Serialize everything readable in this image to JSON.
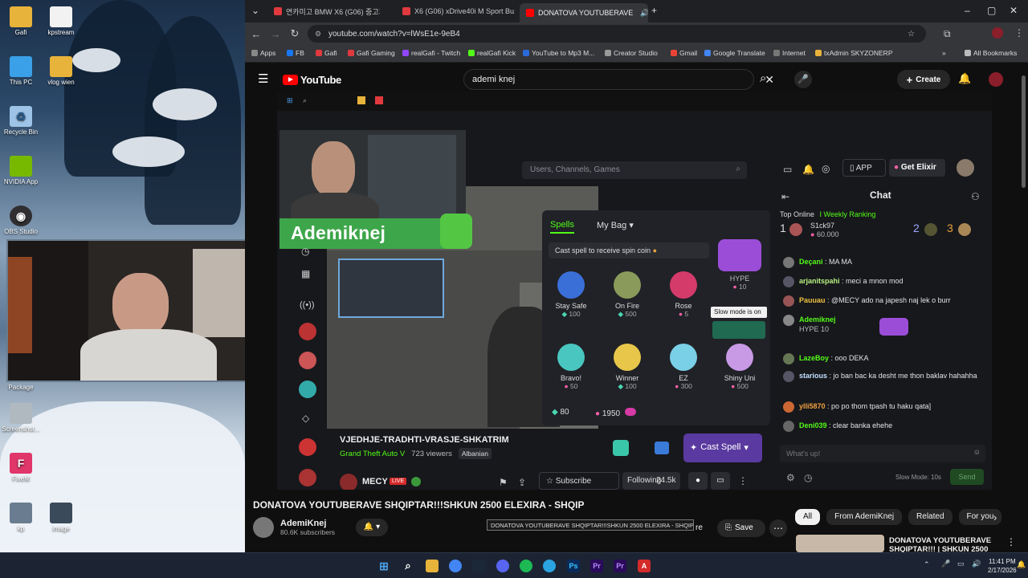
{
  "desktop": {
    "icons": [
      {
        "label": "Gafi",
        "name": "folder-icon",
        "color": "#e8b33a"
      },
      {
        "label": "kpstream",
        "name": "file-icon",
        "color": "#f2f2f2"
      },
      {
        "label": "This PC",
        "name": "computer-icon",
        "color": "#3aa0e8"
      },
      {
        "label": "vlog wien",
        "name": "folder-icon",
        "color": "#e8b33a"
      },
      {
        "label": "Recycle Bin",
        "name": "recycle-bin-icon",
        "color": "#9dc3e6"
      },
      {
        "label": "NVIDIA App",
        "name": "nvidia-icon",
        "color": "#76b900"
      },
      {
        "label": "OBS Studio",
        "name": "obs-icon",
        "color": "#302e31"
      },
      {
        "label": "Package",
        "name": "package-icon",
        "color": "#6a7d90"
      },
      {
        "label": "Screenshot...",
        "name": "screenshot-icon",
        "color": "#b0b8c0"
      },
      {
        "label": "FiveM",
        "name": "fivem-icon",
        "color": "#e0366a"
      },
      {
        "label": "kp",
        "name": "file-icon",
        "color": "#6a7d90"
      },
      {
        "label": "image",
        "name": "image-icon",
        "color": "#3a4a5a"
      }
    ]
  },
  "browser": {
    "tabs": [
      {
        "title": "연카미고 BMW X6 (G06) 중고차",
        "active": false
      },
      {
        "title": "X6 (G06) xDrive40i M Sport Bu...",
        "active": false
      },
      {
        "title": "DONATOVA YOUTUBERAVE",
        "active": true
      }
    ],
    "new_tab": "+",
    "url": "youtube.com/watch?v=lWsE1e-9eB4",
    "bookmarks": [
      "Apps",
      "FB",
      "Gafi",
      "Gafi Gaming",
      "realGafi - Twitch",
      "realGafi Kick",
      "YouTube to Mp3 M...",
      "Creator Studio",
      "Gmail",
      "Google Translate",
      "Internet",
      "txAdmin SKYZONERP"
    ],
    "bookmarks_more": "»",
    "all_bookmarks": "All Bookmarks"
  },
  "youtube": {
    "logo": "YouTube",
    "search_value": "ademi knej",
    "create_label": "Create",
    "video_title": "DONATOVA YOUTUBERAVE SHQIPTAR!!!SHKUN 2500 ELEXIRA - SHQIP",
    "tooltip": "DONATOVA YOUTUBERAVE SHQIPTAR!!!SHKUN 2500 ELEXIRA - SHQIP",
    "channel_name": "AdemiKnej",
    "subscribers": "80.6K subscribers",
    "save_label": "Save",
    "share_partial": "re",
    "chips": [
      "All",
      "From AdemiKnej",
      "Related",
      "For you"
    ],
    "reco_title": "DONATOVA YOUTUBERAVE SHQIPTAR!!! | SHKUN 2500"
  },
  "kick": {
    "search_placeholder": "Users, Channels, Games",
    "app_label": "APP",
    "get_elixir": "Get Elixir",
    "streamer_banner": "Ademiknej",
    "chat_title": "Chat",
    "top_online": "Top Online",
    "weekly_ranking": "I Weekly Ranking",
    "top_user": "S1ck97",
    "top_value": "60.000",
    "rank1": "1",
    "rank2": "2",
    "rank3": "3",
    "spells_tab": "Spells",
    "bag_tab": "My Bag",
    "cast_hint": "Cast spell to receive spin coin",
    "spells": [
      {
        "name": "Stay Safe",
        "cost": "100",
        "color": "#3b6fd8"
      },
      {
        "name": "On Fire",
        "cost": "500",
        "color": "#8a9a5a"
      },
      {
        "name": "Rose",
        "cost": "5",
        "color": "#d43a6a"
      },
      {
        "name": "HYPE",
        "cost": "10",
        "color": "#9b4dd8"
      },
      {
        "name": "Bravo!",
        "cost": "50",
        "color": "#4ac6c0"
      },
      {
        "name": "Winner",
        "cost": "100",
        "color": "#e8c64a"
      },
      {
        "name": "EZ",
        "cost": "300",
        "color": "#7ad0e6"
      },
      {
        "name": "Shiny Uni",
        "cost": "500",
        "color": "#c89ae6"
      }
    ],
    "slow_mode_tip": "Slow mode is on",
    "balance_green": "80",
    "balance_pink": "1950",
    "stream_title": "VJEDHJE-TRADHTI-VRASJE-SHKATRIM",
    "category": "Grand Theft Auto V",
    "viewers": "723 viewers",
    "language": "Albanian",
    "cast_spell_label": "Cast Spell",
    "channel_name": "MECY",
    "live_badge": "LIVE",
    "subscribe_label": "Subscribe",
    "following_label": "Following",
    "followers": "24.5k",
    "chat_messages": [
      {
        "user": "Deçani",
        "text": "MA MA"
      },
      {
        "user": "arjanitspahi",
        "text": "meci a mnon mod"
      },
      {
        "user": "Pauuau",
        "text": "@MECY ado na japesh naj lek o burr"
      },
      {
        "user": "Ademiknej",
        "text": "HYPE  10"
      },
      {
        "user": "LazeBoy",
        "text": "ooo DEKA"
      },
      {
        "user": "starious",
        "text": "jo ban bac ka desht me thon baklav hahahha"
      },
      {
        "user": "ylli5870",
        "text": "po po thom tpash tu haku qata]"
      },
      {
        "user": "Deni039",
        "text": "clear banka ehehe"
      }
    ],
    "chat_placeholder": "What's up!",
    "slow_mode_label": "Slow Mode: 10s",
    "send_label": "Send"
  },
  "taskbar": {
    "time": "11:41 PM",
    "date": "2/17/2026"
  }
}
